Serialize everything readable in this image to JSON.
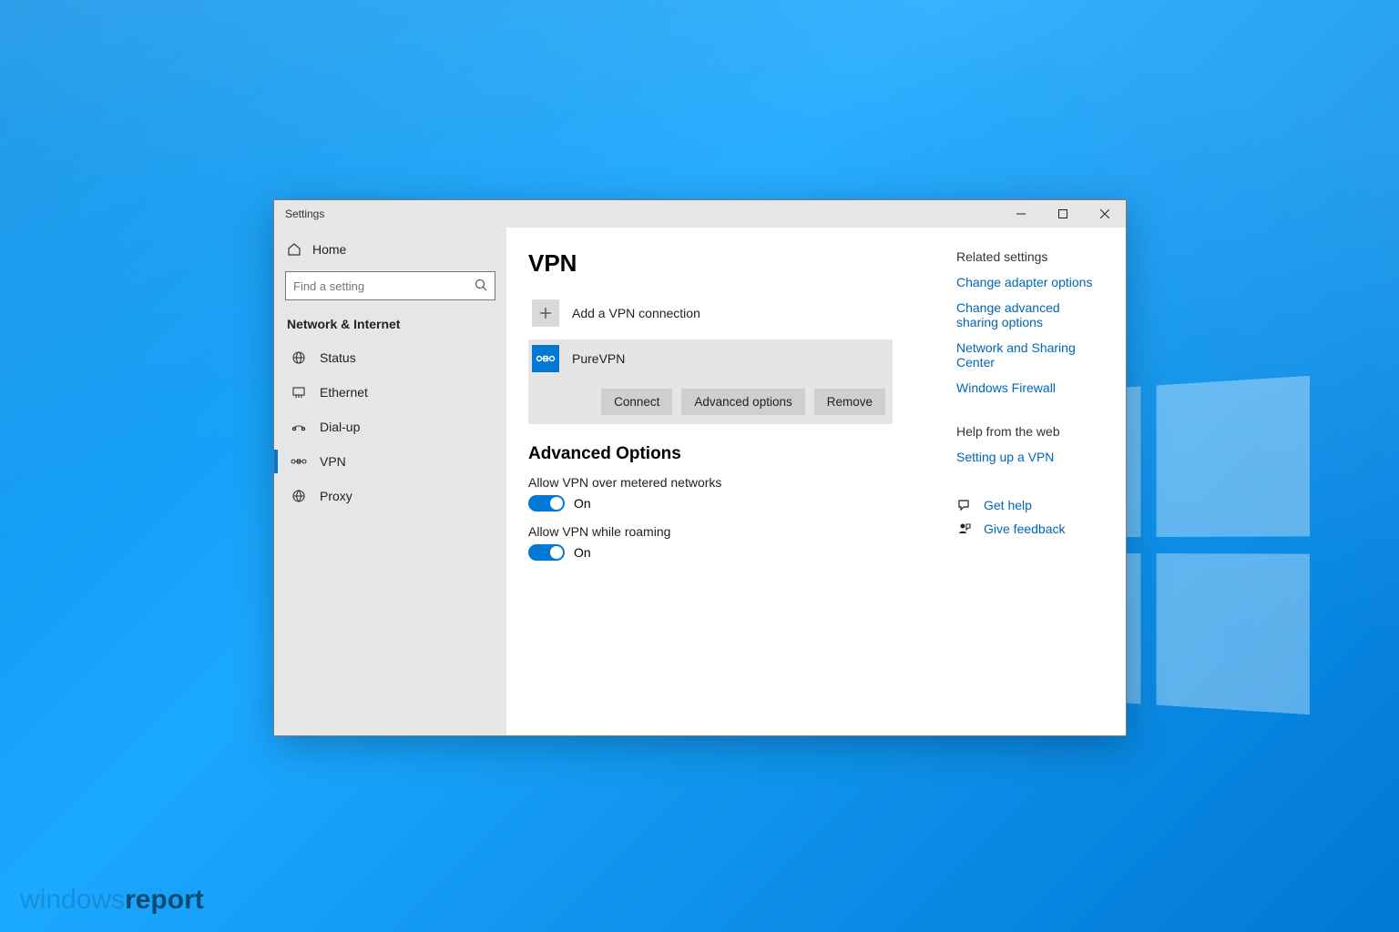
{
  "window": {
    "title": "Settings"
  },
  "sidebar": {
    "home": "Home",
    "search_placeholder": "Find a setting",
    "section": "Network & Internet",
    "items": [
      {
        "label": "Status"
      },
      {
        "label": "Ethernet"
      },
      {
        "label": "Dial-up"
      },
      {
        "label": "VPN"
      },
      {
        "label": "Proxy"
      }
    ]
  },
  "main": {
    "title": "VPN",
    "add_label": "Add a VPN connection",
    "connection": {
      "name": "PureVPN",
      "buttons": {
        "connect": "Connect",
        "advanced": "Advanced options",
        "remove": "Remove"
      }
    },
    "advanced_heading": "Advanced Options",
    "options": [
      {
        "label": "Allow VPN over metered networks",
        "state": "On"
      },
      {
        "label": "Allow VPN while roaming",
        "state": "On"
      }
    ]
  },
  "related": {
    "heading": "Related settings",
    "links": [
      "Change adapter options",
      "Change advanced sharing options",
      "Network and Sharing Center",
      "Windows Firewall"
    ]
  },
  "webhelp": {
    "heading": "Help from the web",
    "links": [
      "Setting up a VPN"
    ]
  },
  "support": {
    "get_help": "Get help",
    "give_feedback": "Give feedback"
  },
  "watermark": {
    "a": "windows",
    "b": "report"
  }
}
